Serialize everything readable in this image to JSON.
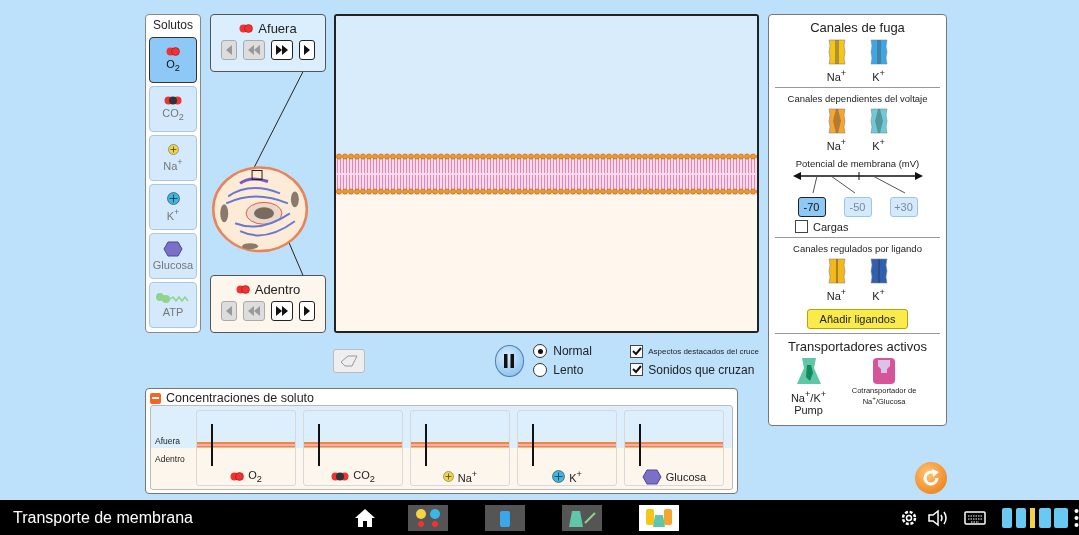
{
  "solutes": {
    "title": "Solutos",
    "items": [
      {
        "kind": "o2",
        "label": "O$_{2}$",
        "selected": true
      },
      {
        "kind": "co2",
        "label": "CO$_{2}$",
        "selected": false
      },
      {
        "kind": "na",
        "label": "Na$^{+}$",
        "selected": false
      },
      {
        "kind": "k",
        "label": "K$^{+}$",
        "selected": false
      },
      {
        "kind": "glucose",
        "label": "Glucosa",
        "selected": false
      },
      {
        "kind": "atp",
        "label": "ATP",
        "selected": false
      }
    ]
  },
  "compartments": [
    {
      "kind": "outside",
      "label": "Afuera",
      "buttons": [
        {
          "kind": "step-back",
          "disabled": true
        },
        {
          "kind": "rewind",
          "disabled": true
        },
        {
          "kind": "fast-forward",
          "disabled": false
        },
        {
          "kind": "step-forward",
          "disabled": false
        }
      ]
    },
    {
      "kind": "inside",
      "label": "Adentro",
      "buttons": [
        {
          "kind": "step-back",
          "disabled": true
        },
        {
          "kind": "rewind",
          "disabled": true
        },
        {
          "kind": "fast-forward",
          "disabled": false
        },
        {
          "kind": "step-forward",
          "disabled": false
        }
      ]
    }
  ],
  "controls": {
    "speeds": [
      {
        "label": "Normal",
        "selected": true
      },
      {
        "label": "Lento",
        "selected": false
      }
    ],
    "options": [
      {
        "kind": "highlights",
        "label": "Aspectos destacados del cruce",
        "checked": true
      },
      {
        "kind": "sounds",
        "label": "Sonidos que cruzan",
        "checked": true
      }
    ]
  },
  "concentrations": {
    "title": "Concentraciones de soluto",
    "expanded": true,
    "rows": [
      "Afuera",
      "Adentro"
    ],
    "columns": [
      {
        "kind": "o2",
        "label": "O$_{2}$"
      },
      {
        "kind": "co2",
        "label": "CO$_{2}$"
      },
      {
        "kind": "na",
        "label": "Na$^{+}$"
      },
      {
        "kind": "k",
        "label": "K$^{+}$"
      },
      {
        "kind": "glucose",
        "label": "Glucosa"
      }
    ]
  },
  "channels_panel": {
    "sections": [
      {
        "kind": "leak",
        "title": "Canales de fuga",
        "channels": [
          {
            "label": "Na$^{+}$",
            "color": "#f5c518"
          },
          {
            "label": "K$^{+}$",
            "color": "#3aa7e8"
          }
        ]
      },
      {
        "kind": "voltage",
        "title": "Canales dependientes del voltaje",
        "channels": [
          {
            "label": "Na$^{+}$",
            "color": "#f7a531"
          },
          {
            "label": "K$^{+}$",
            "color": "#6ccbd9"
          }
        ],
        "potential": {
          "title": "Potencial de membrana (mV)",
          "values": [
            {
              "label": "-70",
              "selected": true
            },
            {
              "label": "-50",
              "selected": false
            },
            {
              "label": "+30",
              "selected": false
            }
          ]
        },
        "charges": {
          "label": "Cargas",
          "checked": false
        }
      },
      {
        "kind": "ligand",
        "title": "Canales regulados por ligando",
        "channels": [
          {
            "label": "Na$^{+}$",
            "color": "#f5b81c"
          },
          {
            "label": "K$^{+}$",
            "color": "#2f5fb0"
          }
        ],
        "button": "Añadir ligandos"
      },
      {
        "kind": "active",
        "title": "Transportadores activos",
        "transporters": [
          {
            "kind": "pump",
            "label": "Na$^{+}$/K$^{+}$\nPump"
          },
          {
            "kind": "cotransporter",
            "label": "Cotransportador de Na$^{+}$/Glucosa"
          }
        ]
      }
    ]
  },
  "navbar": {
    "title": "Transporte de membrana",
    "screens": [
      {
        "kind": "simple",
        "selected": false
      },
      {
        "kind": "facilitated",
        "selected": false
      },
      {
        "kind": "active",
        "selected": false
      },
      {
        "kind": "playground",
        "selected": true
      }
    ]
  }
}
